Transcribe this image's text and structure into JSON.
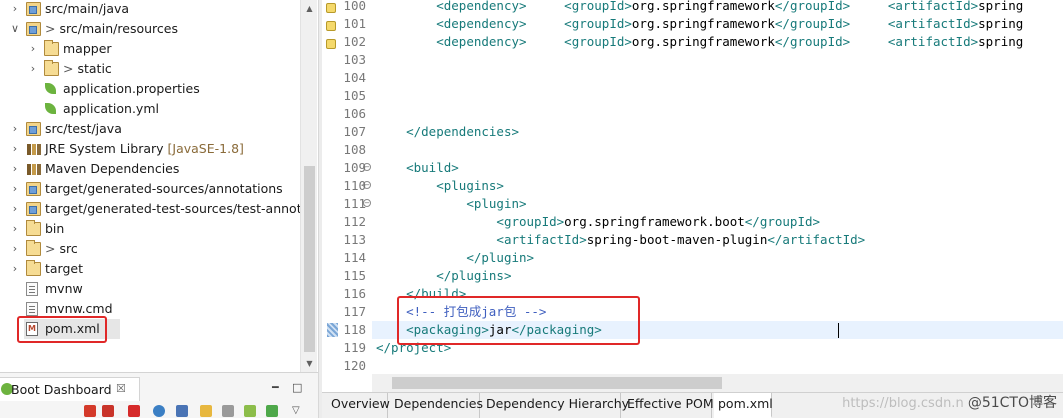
{
  "explorer": {
    "items": [
      {
        "label": "src/main/java",
        "deco": "",
        "prefix": "",
        "icon": "source-folder-icon",
        "expanded": "collapsed",
        "indent": 0
      },
      {
        "label": "src/main/resources",
        "deco": "",
        "prefix": ">",
        "icon": "source-folder-icon",
        "expanded": "expanded",
        "indent": 0
      },
      {
        "label": "mapper",
        "deco": "",
        "prefix": "",
        "icon": "folder-icon",
        "expanded": "collapsed",
        "indent": 1
      },
      {
        "label": "static",
        "deco": "",
        "prefix": ">",
        "icon": "folder-icon",
        "expanded": "collapsed",
        "indent": 1
      },
      {
        "label": "application.properties",
        "deco": "",
        "prefix": "",
        "icon": "spring-config-icon",
        "expanded": "none",
        "indent": 1
      },
      {
        "label": "application.yml",
        "deco": "",
        "prefix": "",
        "icon": "spring-config-icon",
        "expanded": "none",
        "indent": 1
      },
      {
        "label": "src/test/java",
        "deco": "",
        "prefix": "",
        "icon": "source-folder-icon",
        "expanded": "collapsed",
        "indent": 0
      },
      {
        "label": "JRE System Library",
        "deco": "[JavaSE-1.8]",
        "prefix": "",
        "icon": "library-icon",
        "expanded": "collapsed",
        "indent": 0
      },
      {
        "label": "Maven Dependencies",
        "deco": "",
        "prefix": "",
        "icon": "library-icon",
        "expanded": "collapsed",
        "indent": 0
      },
      {
        "label": "target/generated-sources/annotations",
        "deco": "",
        "prefix": "",
        "icon": "source-folder-icon",
        "expanded": "collapsed",
        "indent": 0
      },
      {
        "label": "target/generated-test-sources/test-annotations",
        "deco": "",
        "prefix": "",
        "icon": "source-folder-icon",
        "expanded": "collapsed",
        "indent": 0
      },
      {
        "label": "bin",
        "deco": "",
        "prefix": "",
        "icon": "folder-icon",
        "expanded": "collapsed",
        "indent": 0
      },
      {
        "label": "src",
        "deco": "",
        "prefix": ">",
        "icon": "folder-icon",
        "expanded": "collapsed",
        "indent": 0
      },
      {
        "label": "target",
        "deco": "",
        "prefix": "",
        "icon": "folder-icon",
        "expanded": "collapsed",
        "indent": 0
      },
      {
        "label": "mvnw",
        "deco": "",
        "prefix": "",
        "icon": "file-icon",
        "expanded": "none",
        "indent": 0
      },
      {
        "label": "mvnw.cmd",
        "deco": "",
        "prefix": "",
        "icon": "file-icon",
        "expanded": "none",
        "indent": 0
      },
      {
        "label": "pom.xml",
        "deco": "",
        "prefix": "",
        "icon": "pom-file-icon",
        "expanded": "none",
        "indent": 0
      }
    ]
  },
  "dashboard": {
    "title": "Boot Dashboard",
    "close_glyph": "☒",
    "minimize_glyph": "━",
    "maximize_glyph": "□",
    "menu_glyph": "▽"
  },
  "editor": {
    "lines": [
      {
        "num": "100",
        "html": "        <span class=\"tag\">&lt;dependency&gt;</span>     <span class=\"tag\">&lt;groupId&gt;</span>org.springframework<span class=\"tag\">&lt;/groupId&gt;</span>     <span class=\"tag\">&lt;artifactId&gt;</span>spring"
      },
      {
        "num": "101",
        "html": "        <span class=\"tag\">&lt;dependency&gt;</span>     <span class=\"tag\">&lt;groupId&gt;</span>org.springframework<span class=\"tag\">&lt;/groupId&gt;</span>     <span class=\"tag\">&lt;artifactId&gt;</span>spring"
      },
      {
        "num": "102",
        "html": "        <span class=\"tag\">&lt;dependency&gt;</span>     <span class=\"tag\">&lt;groupId&gt;</span>org.springframework<span class=\"tag\">&lt;/groupId&gt;</span>     <span class=\"tag\">&lt;artifactId&gt;</span>spring"
      },
      {
        "num": "103",
        "html": ""
      },
      {
        "num": "104",
        "html": ""
      },
      {
        "num": "105",
        "html": ""
      },
      {
        "num": "106",
        "html": ""
      },
      {
        "num": "107",
        "html": "    <span class=\"tag\">&lt;/dependencies&gt;</span>"
      },
      {
        "num": "108",
        "html": ""
      },
      {
        "num": "109",
        "html": "    <span class=\"tag\">&lt;build&gt;</span>"
      },
      {
        "num": "110",
        "html": "        <span class=\"tag\">&lt;plugins&gt;</span>"
      },
      {
        "num": "111",
        "html": "            <span class=\"tag\">&lt;plugin&gt;</span>"
      },
      {
        "num": "112",
        "html": "                <span class=\"tag\">&lt;groupId&gt;</span>org.springframework.boot<span class=\"tag\">&lt;/groupId&gt;</span>"
      },
      {
        "num": "113",
        "html": "                <span class=\"tag\">&lt;artifactId&gt;</span>spring-boot-maven-plugin<span class=\"tag\">&lt;/artifactId&gt;</span>"
      },
      {
        "num": "114",
        "html": "            <span class=\"tag\">&lt;/plugin&gt;</span>"
      },
      {
        "num": "115",
        "html": "        <span class=\"tag\">&lt;/plugins&gt;</span>"
      },
      {
        "num": "116",
        "html": "    <span class=\"tag\">&lt;/build&gt;</span>"
      },
      {
        "num": "117",
        "html": "    <span class=\"cmt\">&lt;!-- 打包成jar包 --&gt;</span>"
      },
      {
        "num": "118",
        "html": "    <span class=\"tag\">&lt;packaging&gt;</span>jar<span class=\"tag\">&lt;/packaging&gt;</span>"
      },
      {
        "num": "119",
        "html": "<span class=\"tag\">&lt;/project&gt;</span>"
      },
      {
        "num": "120",
        "html": ""
      }
    ]
  },
  "editor_tabs": [
    {
      "label": "Overview",
      "active": "false"
    },
    {
      "label": "Dependencies",
      "active": "false"
    },
    {
      "label": "Dependency Hierarchy",
      "active": "false"
    },
    {
      "label": "Effective POM",
      "active": "false"
    },
    {
      "label": "pom.xml",
      "active": "true"
    }
  ],
  "watermark": {
    "url": "https://blog.csdn.n",
    "brand": "@51CTO博客"
  },
  "colors": {
    "tag": "#177a7a",
    "comment": "#3f5fbf",
    "highlight_box": "#e02828",
    "current_line": "#e8f2fe"
  }
}
